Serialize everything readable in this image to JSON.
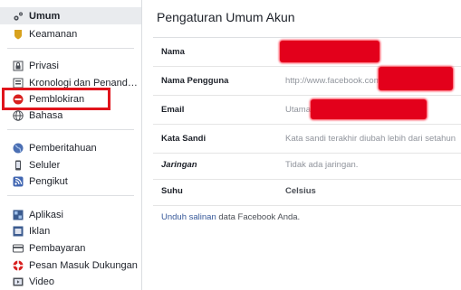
{
  "sidebar": {
    "items": [
      {
        "label": "Umum",
        "icon": "gear-icon"
      },
      {
        "label": "Keamanan",
        "icon": "shield-icon"
      },
      {
        "label": "Privasi",
        "icon": "lock-icon"
      },
      {
        "label": "Kronologi dan Penanda...",
        "icon": "timeline-icon"
      },
      {
        "label": "Pemblokiran",
        "icon": "block-icon"
      },
      {
        "label": "Bahasa",
        "icon": "globe-icon"
      },
      {
        "label": "Pemberitahuan",
        "icon": "notification-globe-icon"
      },
      {
        "label": "Seluler",
        "icon": "mobile-phone-icon"
      },
      {
        "label": "Pengikut",
        "icon": "rss-icon"
      },
      {
        "label": "Aplikasi",
        "icon": "apps-icon"
      },
      {
        "label": "Iklan",
        "icon": "ads-icon"
      },
      {
        "label": "Pembayaran",
        "icon": "payment-card-icon"
      },
      {
        "label": "Pesan Masuk Dukungan",
        "icon": "lifebuoy-icon"
      },
      {
        "label": "Video",
        "icon": "video-icon"
      }
    ]
  },
  "main": {
    "title": "Pengaturan Umum Akun",
    "rows": [
      {
        "label": "Nama",
        "value": ""
      },
      {
        "label": "Nama Pengguna",
        "value": "http://www.facebook.com"
      },
      {
        "label": "Email",
        "value": "Utama:"
      },
      {
        "label": "Kata Sandi",
        "value": "Kata sandi terakhir diubah lebih dari setahun"
      },
      {
        "label": "Jaringan",
        "value": "Tidak ada jaringan."
      },
      {
        "label": "Suhu",
        "value": "Celsius"
      }
    ],
    "footer_link": "Unduh salinan",
    "footer_text": " data Facebook Anda."
  },
  "colors": {
    "highlight": "#e0141c",
    "redaction": "#e3001b",
    "link": "#365899"
  }
}
